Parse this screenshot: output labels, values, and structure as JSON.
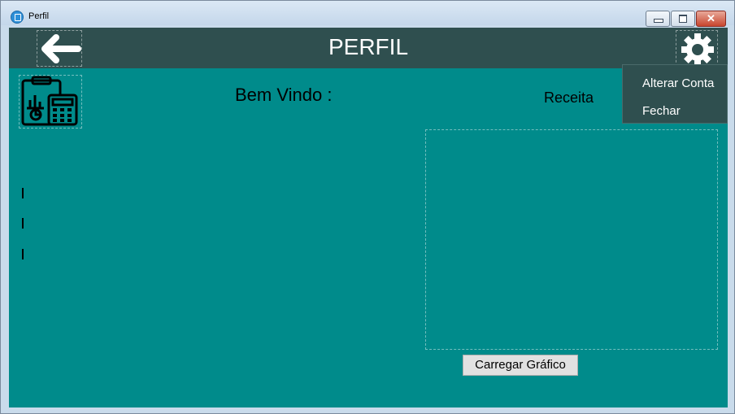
{
  "window": {
    "title": "Perfil",
    "controls": {
      "minimize": "minimize-icon",
      "maximize": "maximize-icon",
      "close": "✕"
    }
  },
  "header": {
    "title": "PERFIL",
    "back_icon": "arrow-left-icon",
    "settings_icon": "gear-icon"
  },
  "main": {
    "welcome_text": "Bem Vindo :",
    "revenue_label": "Receita",
    "info_markers": [
      "|",
      "|",
      "|"
    ],
    "load_chart_button": "Carregar Gráfico"
  },
  "settings_menu": {
    "items": [
      "Alterar Conta",
      "Fechar"
    ]
  },
  "colors": {
    "background": "#008b8b",
    "header": "#2f4f4f",
    "menu": "#2f4f4f"
  }
}
